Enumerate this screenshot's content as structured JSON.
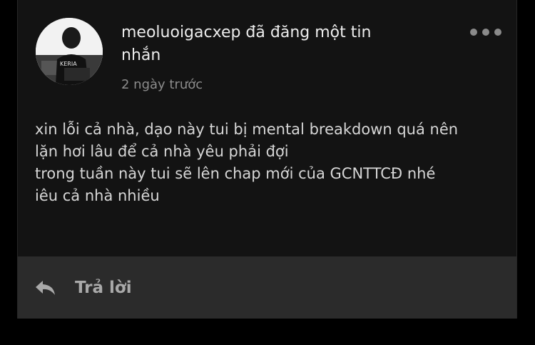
{
  "post": {
    "header": "meoluoigacxep đã đăng một tin nhắn",
    "timestamp": "2 ngày trước",
    "avatar_text": "KERIA",
    "message_lines": [
      "xin lỗi cả nhà, dạo này tui bị mental breakdown quá nên",
      "lặn hơi lâu  để cả nhà yêu phải đợi",
      "trong tuần này tui sẽ lên chap mới của GCNTTCĐ nhé",
      "iêu cả nhà nhiều"
    ]
  },
  "actions": {
    "more_icon": "more-horizontal-icon",
    "reply_icon": "reply-arrow-icon",
    "reply_label": "Trả lời"
  },
  "colors": {
    "background": "#000000",
    "card": "#131313",
    "reply_bar": "#2b2b2b",
    "text": "#d6d6d6",
    "muted": "#8c8c8c"
  }
}
